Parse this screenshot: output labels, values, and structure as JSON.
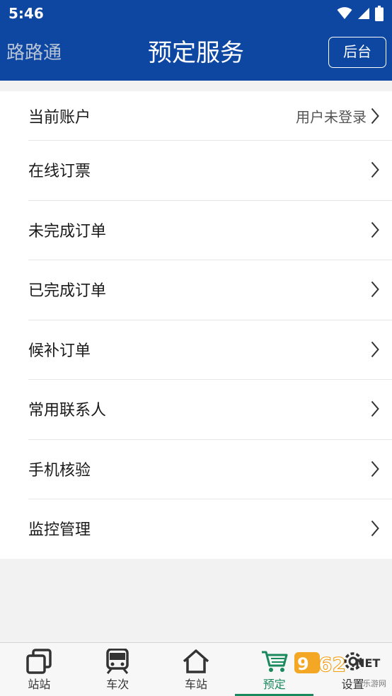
{
  "status_bar": {
    "time": "5:46"
  },
  "header": {
    "app_name": "路路通",
    "title": "预定服务",
    "backend_button": "后台"
  },
  "menu": [
    {
      "label": "当前账户",
      "value": "用户未登录"
    },
    {
      "label": "在线订票"
    },
    {
      "label": "未完成订单"
    },
    {
      "label": "已完成订单"
    },
    {
      "label": "候补订单"
    },
    {
      "label": "常用联系人"
    },
    {
      "label": "手机核验"
    },
    {
      "label": "监控管理"
    }
  ],
  "bottom_nav": [
    {
      "label": "站站",
      "icon": "copy-icon"
    },
    {
      "label": "车次",
      "icon": "train-icon"
    },
    {
      "label": "车站",
      "icon": "home-icon"
    },
    {
      "label": "预定",
      "icon": "cart-icon",
      "active": true
    },
    {
      "label": "设置",
      "icon": "gear-icon"
    }
  ],
  "watermark": {
    "logo_text": "962",
    "logo_suffix": ".NET",
    "sub_text": "乐游网"
  },
  "colors": {
    "header_bg": "#0d47a1",
    "active_nav": "#1a8a5e",
    "page_bg": "#f2f2f2"
  }
}
